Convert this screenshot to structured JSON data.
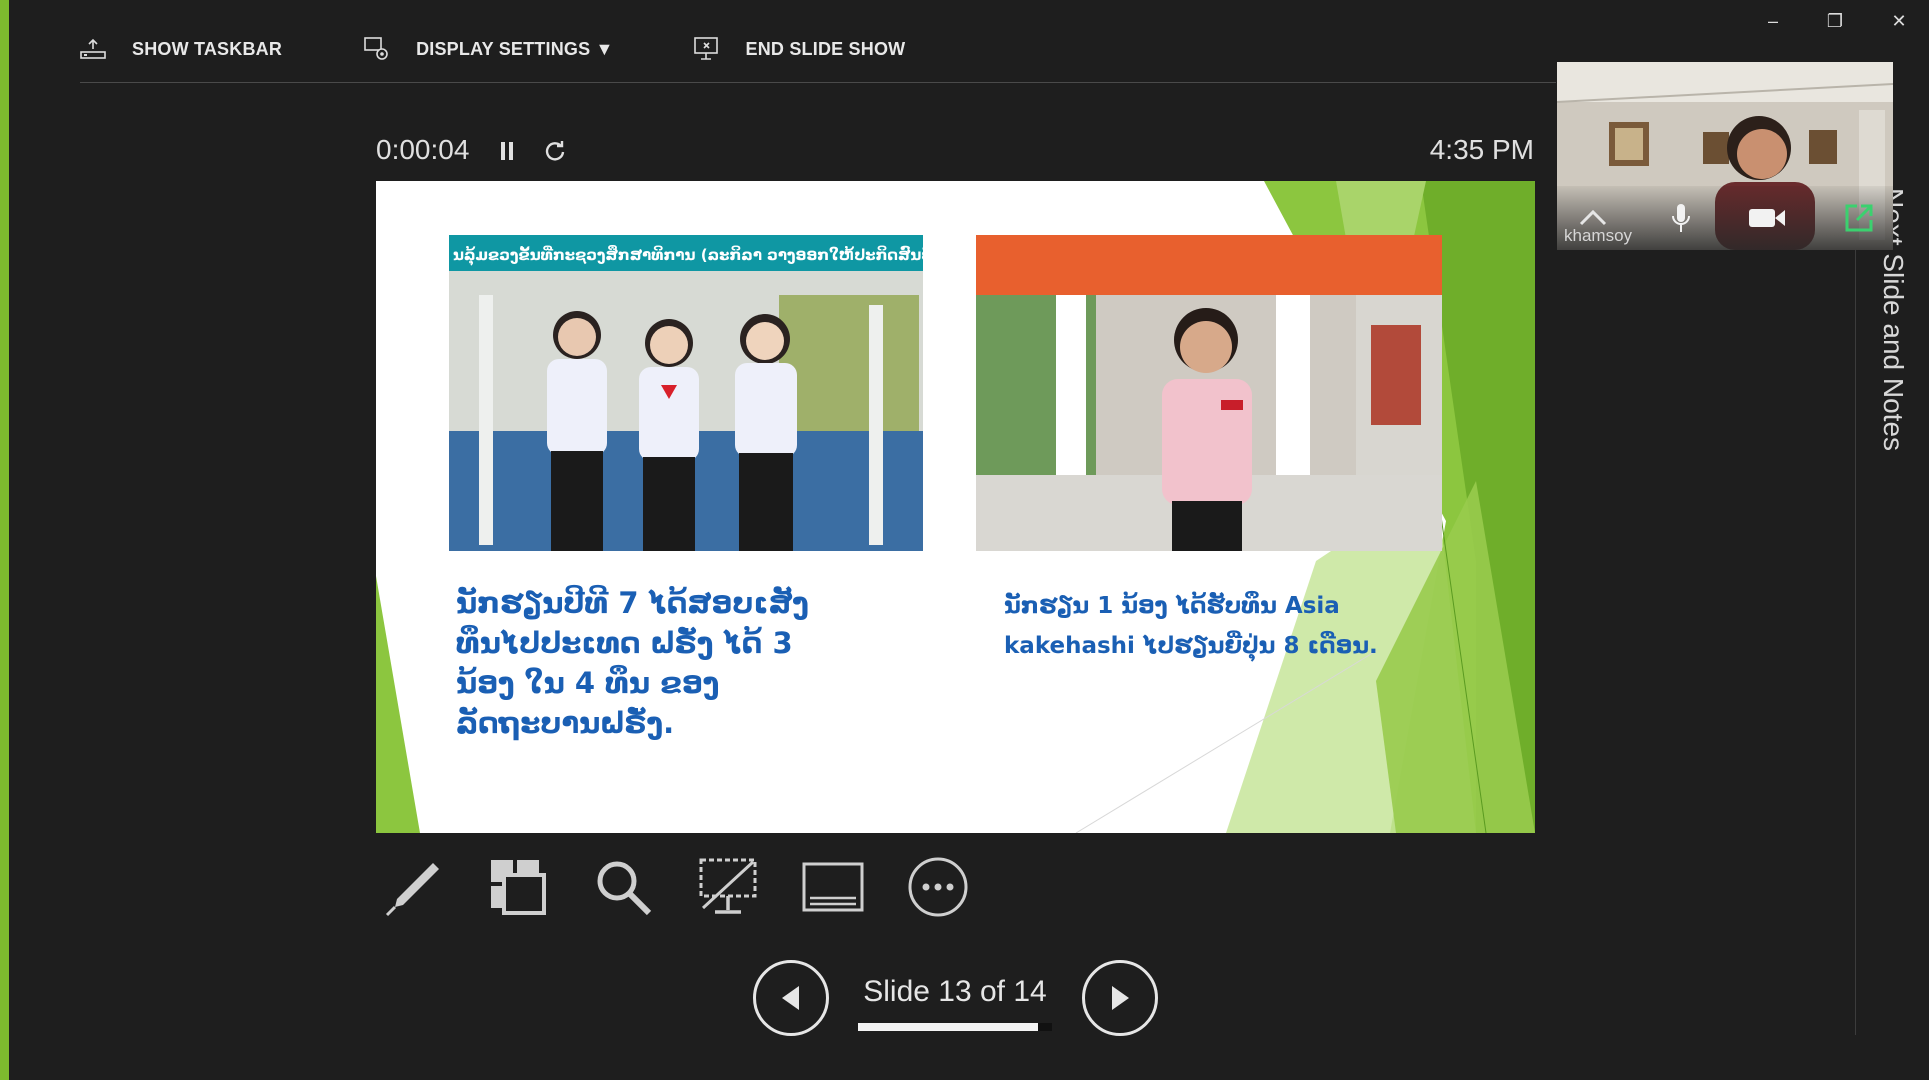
{
  "window": {
    "minimize": "–",
    "restore": "❐",
    "close": "✕"
  },
  "toolbar": {
    "show_taskbar": "SHOW TASKBAR",
    "display_settings": "DISPLAY SETTINGS ▼",
    "end_slide_show": "END SLIDE SHOW"
  },
  "timer": {
    "elapsed": "0:00:04",
    "clock": "4:35 PM"
  },
  "slide": {
    "left_caption": [
      "ນັກຮຽນປີທີ 7 ໄດ້ສອບເສັງ",
      "ທຶນໄປປະເທດ ຝຣັ່ງ ໄດ້ 3",
      "ນ້ອງ ໃນ 4 ທຶນ ຂອງ",
      "ລັດຖະບານຝຣັ່ງ."
    ],
    "right_caption": [
      "ນັກຮຽນ 1 ນ້ອງ ໄດ້ຮັບທຶນ Asia",
      "kakehashi ໄປຮຽນຍີ່ປຸ່ນ 8 ເດືອນ."
    ],
    "left_photo_banner": "ນລຸ້ມຂວງຂັ້ນທີ່ກະຊວງສຶກສາທິການ (ລະກິລາ ວາງອອກໃຫ້ປະກິດສົນປັນຈີ)"
  },
  "navigation": {
    "slide_counter": "Slide 13 of 14",
    "progress": 0.93
  },
  "side_panel": {
    "label": "Next Slide and Notes"
  },
  "video": {
    "participant": "khamsoy"
  },
  "colors": {
    "accent_green": "#7dbb2e",
    "text_blue": "#1a5fb4",
    "background": "#1e1e1e"
  }
}
